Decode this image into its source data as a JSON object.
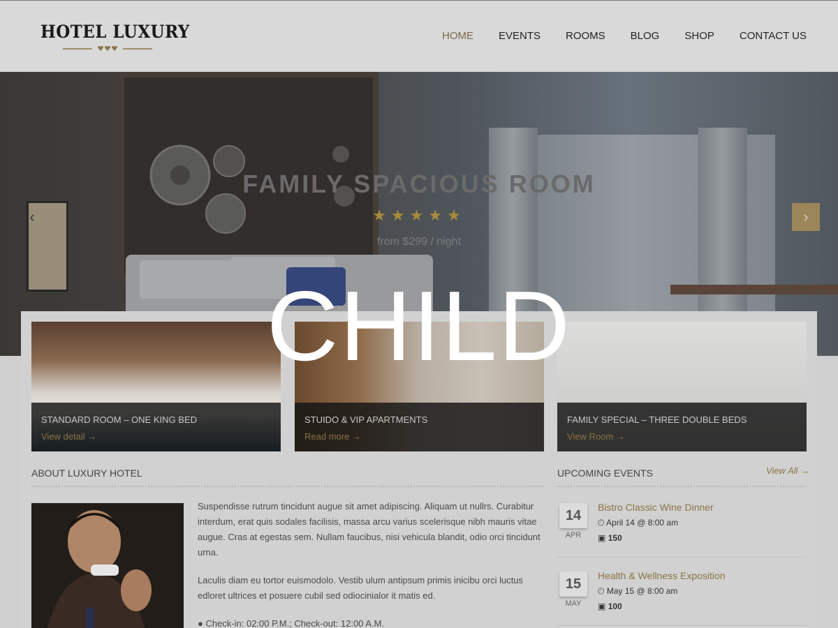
{
  "header": {
    "logo_text": "HOTEL LUXURY",
    "nav": [
      {
        "label": "HOME",
        "active": true
      },
      {
        "label": "EVENTS",
        "active": false
      },
      {
        "label": "ROOMS",
        "active": false
      },
      {
        "label": "BLOG",
        "active": false
      },
      {
        "label": "SHOP",
        "active": false
      },
      {
        "label": "CONTACT US",
        "active": false
      }
    ]
  },
  "hero": {
    "title": "FAMILY SPACIOUS ROOM",
    "stars": "★★★★★",
    "rating": 5,
    "price": "from $299 / night",
    "prev_icon": "chevron-left-icon",
    "next_icon": "chevron-right-icon"
  },
  "watermark": "CHILD",
  "rooms": [
    {
      "title": "STANDARD ROOM – ONE KING BED",
      "link": "View detail →"
    },
    {
      "title": "STUIDO & VIP APARTMENTS",
      "link": "Read more →"
    },
    {
      "title": "FAMILY SPECIAL – THREE DOUBLE BEDS",
      "link": "View Room →"
    }
  ],
  "about": {
    "title": "ABOUT LUXURY HOTEL",
    "para1": "Suspendisse rutrum tincidunt augue sit amet adipiscing. Aliquam ut nullrs. Curabitur interdum, erat quis sodales facilisis, massa arcu varius scelerisque nibh mauris vitae augue. Cras at egestas sem. Nullam faucibus, nisi vehicula blandit, odio orci tincidunt urna.",
    "para2": "Laculis diam eu tortor euismodolo. Vestib ulum antipsum primis inicibu orci luctus edloret ultrices et posuere cubil sed odiocinialor it matis ed.",
    "bullet": "● Check-in: 02:00 P.M.; Check-out: 12:00 A.M."
  },
  "events": {
    "title": "UPCOMING EVENTS",
    "view_all": "View All →",
    "items": [
      {
        "day": "14",
        "month": "APR",
        "title": "Bistro Classic Wine Dinner",
        "when": "April 14 @ 8:00 am",
        "price": "150"
      },
      {
        "day": "15",
        "month": "MAY",
        "title": "Health & Wellness Exposition",
        "when": "May 15 @ 8:00 am",
        "price": "100"
      }
    ]
  },
  "colors": {
    "accent": "#8a7445",
    "nav_active": "#7a6a45"
  }
}
